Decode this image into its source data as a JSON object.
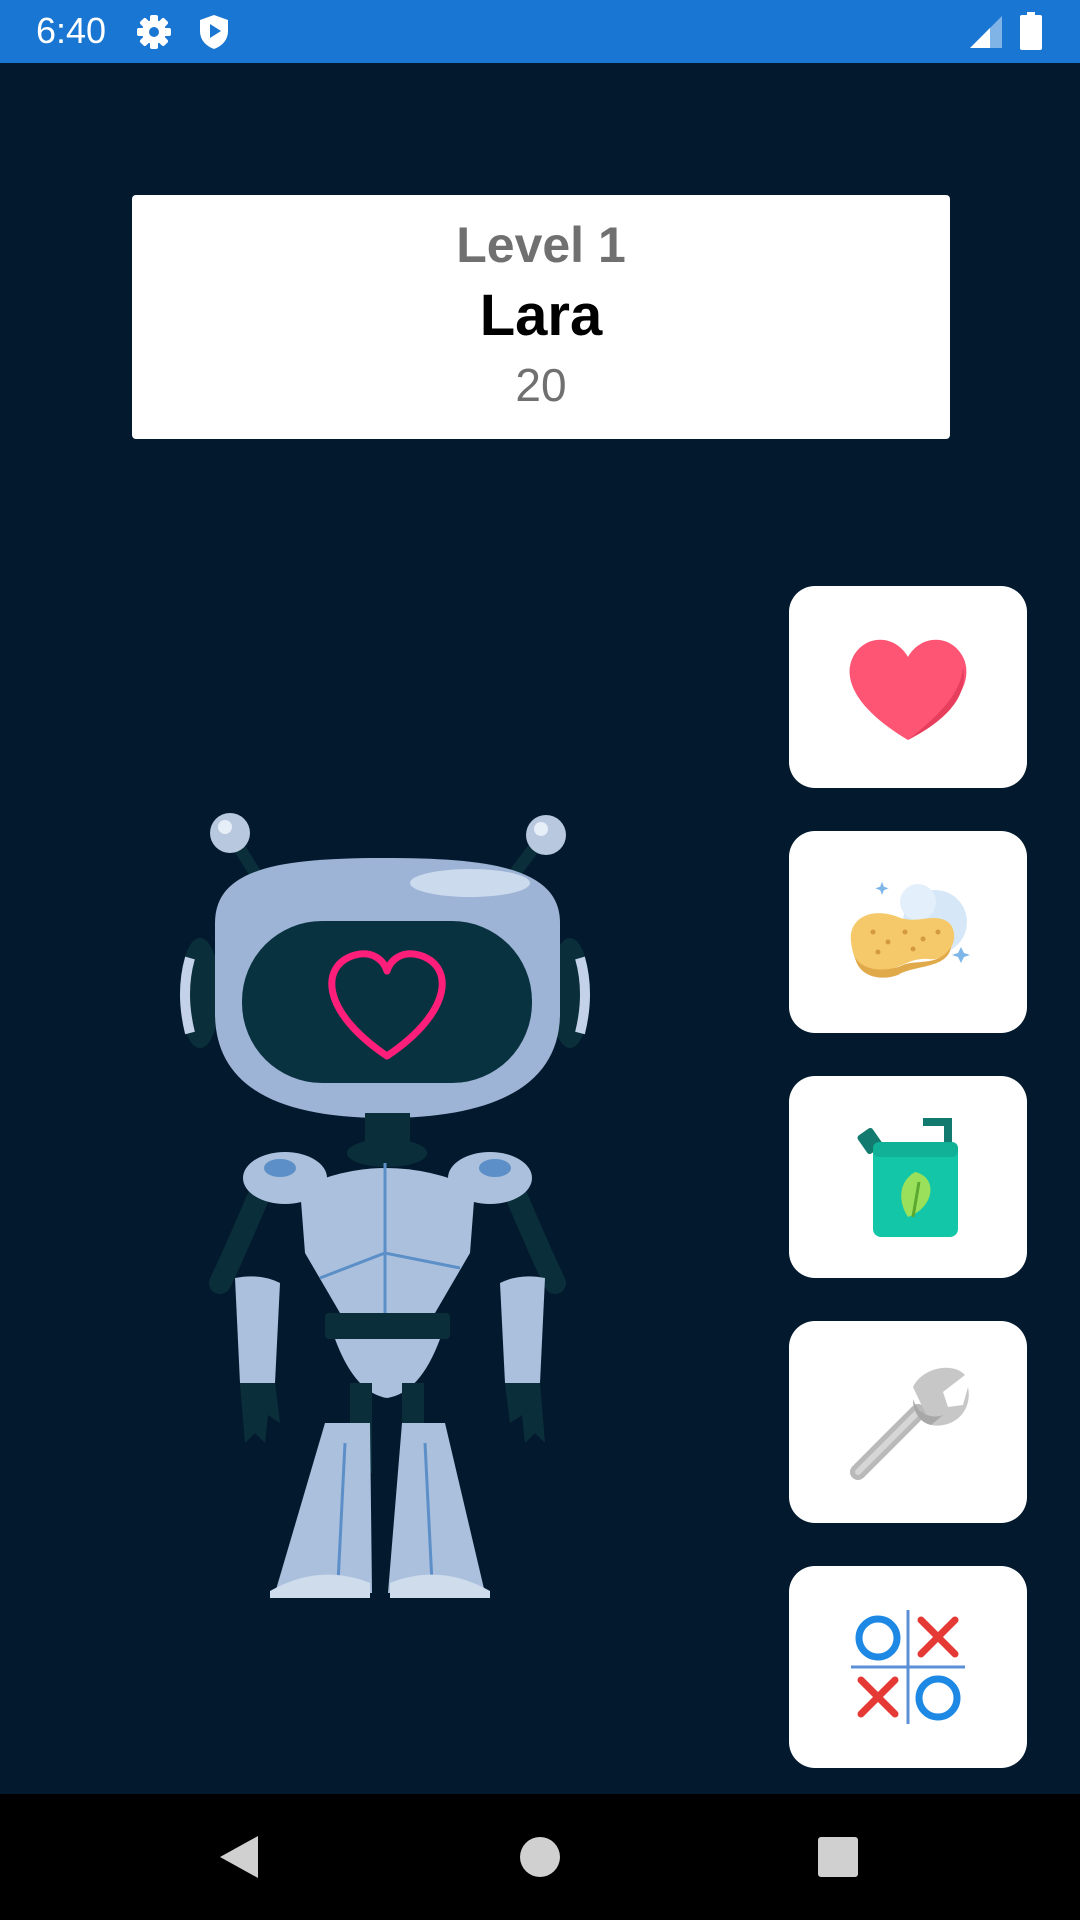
{
  "status_bar": {
    "time": "6:40",
    "icons": [
      "settings-icon",
      "shield-play-icon",
      "signal-icon",
      "battery-icon"
    ],
    "color": "#1976d2"
  },
  "pet_card": {
    "level": "Level 1",
    "name": "Lara",
    "score": "20"
  },
  "robot": {
    "screen_icon": "heart-outline-icon",
    "heart_color": "#ff1f7a"
  },
  "actions": [
    {
      "id": "love",
      "icon": "heart-icon"
    },
    {
      "id": "clean",
      "icon": "sponge-icon"
    },
    {
      "id": "feed",
      "icon": "oil-can-icon"
    },
    {
      "id": "repair",
      "icon": "wrench-icon"
    },
    {
      "id": "play",
      "icon": "tic-tac-toe-icon"
    }
  ],
  "nav_bar": {
    "buttons": [
      "back-icon",
      "home-icon",
      "recents-icon"
    ]
  },
  "colors": {
    "background": "#031a2e",
    "card": "#ffffff",
    "heart": "#ff5574"
  }
}
